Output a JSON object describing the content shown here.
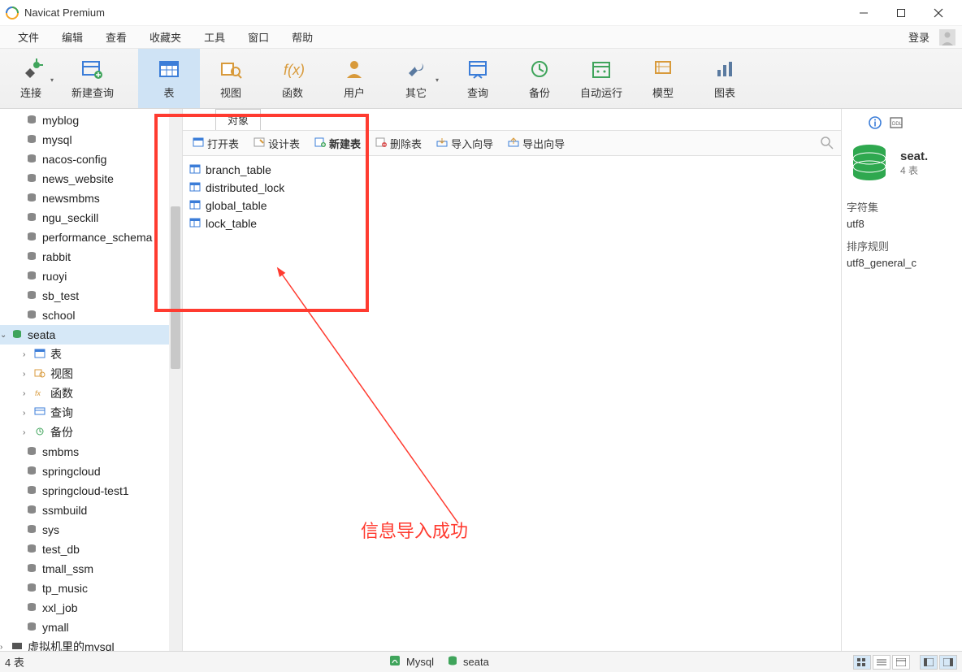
{
  "window": {
    "title": "Navicat Premium"
  },
  "menu": {
    "items": [
      "文件",
      "编辑",
      "查看",
      "收藏夹",
      "工具",
      "窗口",
      "帮助"
    ],
    "login": "登录"
  },
  "toolbar": {
    "connect": "连接",
    "new_query": "新建查询",
    "table": "表",
    "view": "视图",
    "function": "函数",
    "user": "用户",
    "other": "其它",
    "query": "查询",
    "backup": "备份",
    "auto_run": "自动运行",
    "model": "模型",
    "chart": "图表"
  },
  "tree": {
    "databases": [
      "myblog",
      "mysql",
      "nacos-config",
      "news_website",
      "newsmbms",
      "ngu_seckill",
      "performance_schema",
      "rabbit",
      "ruoyi",
      "sb_test",
      "school"
    ],
    "selected": "seata",
    "seata_children": {
      "table": "表",
      "view": "视图",
      "function": "函数",
      "query": "查询",
      "backup": "备份"
    },
    "databases_after": [
      "smbms",
      "springcloud",
      "springcloud-test1",
      "ssmbuild",
      "sys",
      "test_db",
      "tmall_ssm",
      "tp_music",
      "xxl_job",
      "ymall",
      "虚拟机里的mysql"
    ]
  },
  "center": {
    "tab": "对象",
    "objbar": {
      "open": "打开表",
      "design": "设计表",
      "new": "新建表",
      "delete": "删除表",
      "import": "导入向导",
      "export": "导出向导"
    },
    "tables": [
      "branch_table",
      "distributed_lock",
      "global_table",
      "lock_table"
    ]
  },
  "info": {
    "db_name": "seat.",
    "table_count": "4 表",
    "charset_label": "字符集",
    "charset_value": "utf8",
    "collation_label": "排序规则",
    "collation_value": "utf8_general_c"
  },
  "status": {
    "left": "4 表",
    "conn": "Mysql",
    "db": "seata"
  },
  "annotation": {
    "text": "信息导入成功"
  }
}
